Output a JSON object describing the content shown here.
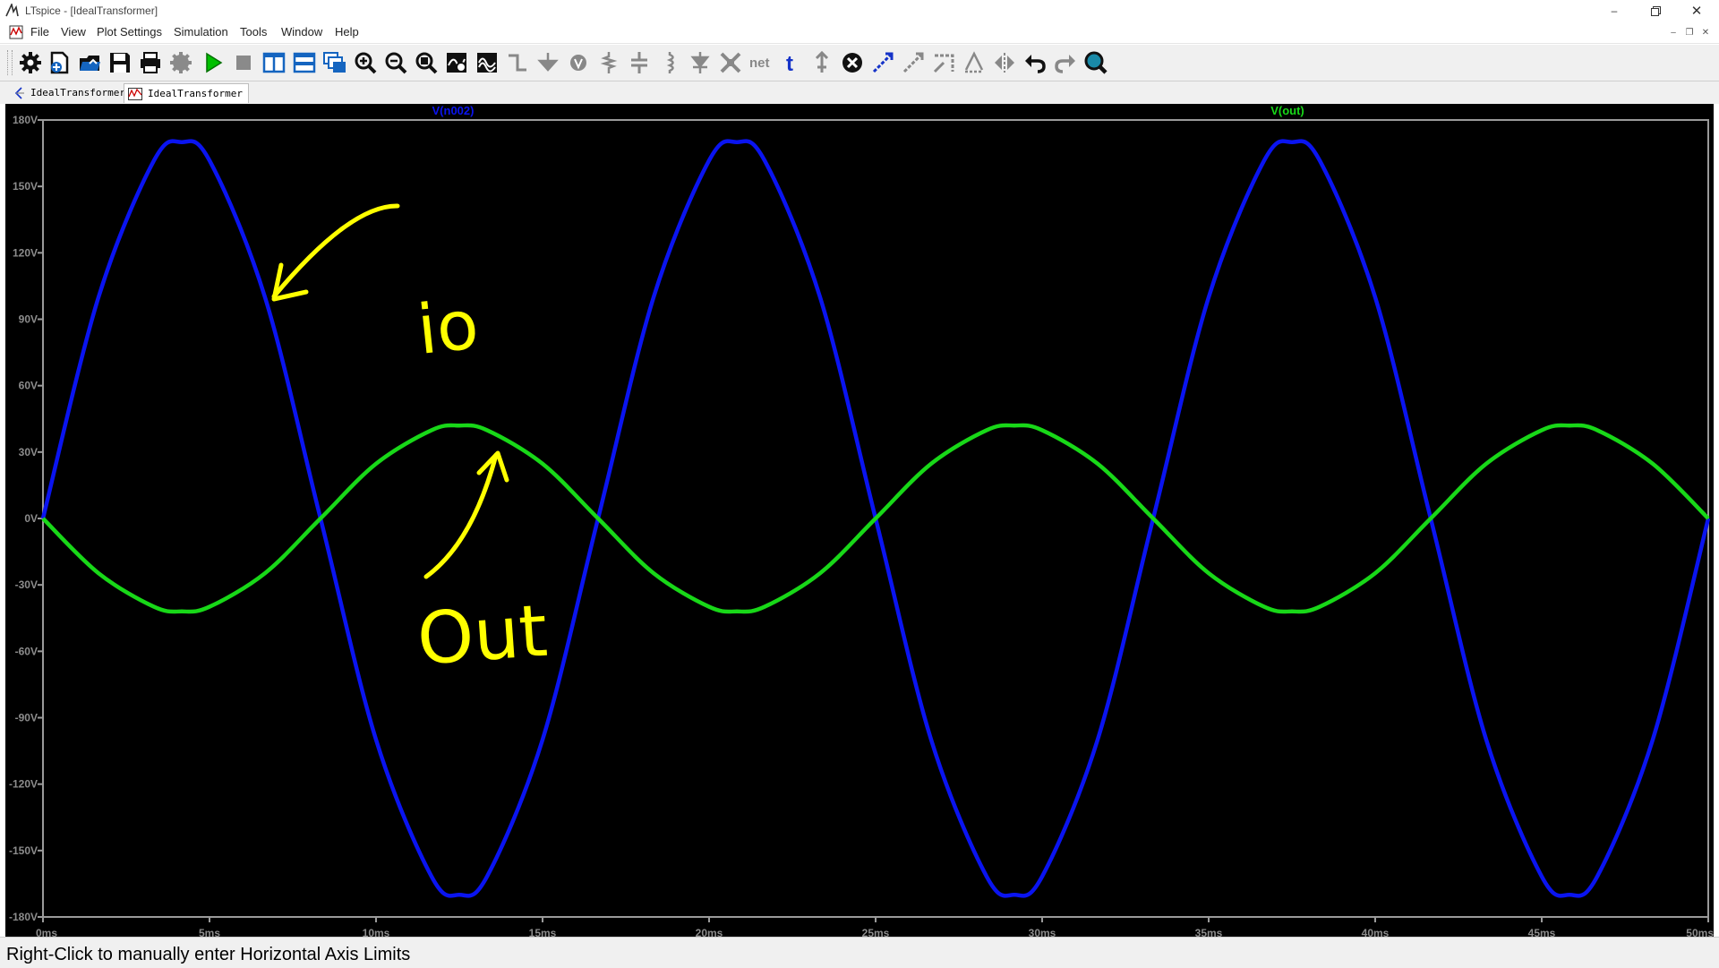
{
  "window": {
    "title": "LTspice - [IdealTransformer]",
    "controls": [
      "minimize",
      "restore",
      "close"
    ]
  },
  "menu": {
    "items": [
      "File",
      "View",
      "Plot Settings",
      "Simulation",
      "Tools",
      "Window",
      "Help"
    ]
  },
  "toolbar": {
    "buttons": [
      {
        "icon": "gear-icon"
      },
      {
        "icon": "new-schematic-icon"
      },
      {
        "icon": "open-icon"
      },
      {
        "icon": "save-icon"
      },
      {
        "icon": "print-icon"
      },
      {
        "icon": "control-panel-icon"
      },
      {
        "icon": "run-icon"
      },
      {
        "icon": "halt-icon"
      },
      {
        "icon": "tile-vertical-icon"
      },
      {
        "icon": "tile-horizontal-icon"
      },
      {
        "icon": "cascade-icon"
      },
      {
        "icon": "zoom-in-icon"
      },
      {
        "icon": "zoom-out-icon"
      },
      {
        "icon": "zoom-fit-icon"
      },
      {
        "icon": "autorange-icon"
      },
      {
        "icon": "waveform-icon"
      },
      {
        "icon": "wire-icon"
      },
      {
        "icon": "ground-icon"
      },
      {
        "icon": "voltage-source-icon"
      },
      {
        "icon": "resistor-icon"
      },
      {
        "icon": "capacitor-icon"
      },
      {
        "icon": "inductor-icon"
      },
      {
        "icon": "diode-icon"
      },
      {
        "icon": "component-icon"
      },
      {
        "icon": "net-label-icon",
        "text": "net"
      },
      {
        "icon": "text-icon",
        "text": "t"
      },
      {
        "icon": "spice-directive-icon"
      },
      {
        "icon": "delete-icon"
      },
      {
        "icon": "move-icon"
      },
      {
        "icon": "drag-icon"
      },
      {
        "icon": "rotate-icon"
      },
      {
        "icon": "mirror-icon"
      },
      {
        "icon": "flip-icon"
      },
      {
        "icon": "undo-icon"
      },
      {
        "icon": "redo-icon"
      },
      {
        "icon": "find-icon"
      }
    ]
  },
  "tabs": [
    {
      "label": "IdealTransformer",
      "icon": "schematic-tab-icon",
      "active": false
    },
    {
      "label": "IdealTransformer",
      "icon": "waveform-tab-icon",
      "active": true
    }
  ],
  "plot": {
    "background": "#000000",
    "trace_colors": {
      "V(n002)": "#0a14f0",
      "V(out)": "#18d818"
    },
    "trace_labels": [
      "V(n002)",
      "V(out)"
    ],
    "annotations": [
      {
        "text": "io",
        "color": "#ffff00",
        "style": "handwritten",
        "points_to": "V(n002)"
      },
      {
        "text": "Out",
        "color": "#ffff00",
        "style": "handwritten",
        "points_to": "V(out)"
      }
    ]
  },
  "chart_data": {
    "type": "line",
    "title": "",
    "xlabel": "",
    "ylabel": "",
    "xlim": [
      0,
      50
    ],
    "ylim": [
      -180,
      180
    ],
    "x_unit": "ms",
    "y_unit": "V",
    "x_ticks": [
      "0ms",
      "5ms",
      "10ms",
      "15ms",
      "20ms",
      "25ms",
      "30ms",
      "35ms",
      "40ms",
      "45ms",
      "50ms"
    ],
    "y_ticks": [
      "180V",
      "150V",
      "120V",
      "90V",
      "60V",
      "30V",
      "0V",
      "-30V",
      "-60V",
      "-90V",
      "-120V",
      "-150V",
      "-180V"
    ],
    "grid": false,
    "x": [
      0,
      1.667,
      3.333,
      4.167,
      5,
      6.667,
      8.333,
      10,
      11.667,
      12.5,
      13.333,
      15,
      16.667,
      18.333,
      20,
      20.833,
      21.667,
      23.333,
      25,
      26.667,
      28.333,
      29.167,
      30,
      31.667,
      33.333,
      35,
      36.667,
      37.5,
      38.333,
      40,
      41.667,
      43.333,
      45,
      45.833,
      46.667,
      48.333,
      50
    ],
    "series": [
      {
        "name": "V(n002)",
        "values": [
          0,
          99.9,
          161.7,
          170,
          161.7,
          99.9,
          0,
          -99.9,
          -161.7,
          -170,
          -161.7,
          -99.9,
          0,
          99.9,
          161.7,
          170,
          161.7,
          99.9,
          0,
          -99.9,
          -161.7,
          -170,
          -161.7,
          -99.9,
          0,
          99.9,
          161.7,
          170,
          161.7,
          99.9,
          0,
          -99.9,
          -161.7,
          -170,
          -161.7,
          -99.9,
          0
        ]
      },
      {
        "name": "V(out)",
        "values": [
          0,
          -24.7,
          -39.9,
          -42,
          -39.9,
          -24.7,
          0,
          24.7,
          39.9,
          42,
          39.9,
          24.7,
          0,
          -24.7,
          -39.9,
          -42,
          -39.9,
          -24.7,
          0,
          24.7,
          39.9,
          42,
          39.9,
          24.7,
          0,
          -24.7,
          -39.9,
          -42,
          -39.9,
          -24.7,
          0,
          24.7,
          39.9,
          42,
          39.9,
          24.7,
          0
        ]
      }
    ]
  },
  "status": {
    "text": "Right-Click to manually enter Horizontal Axis Limits"
  }
}
